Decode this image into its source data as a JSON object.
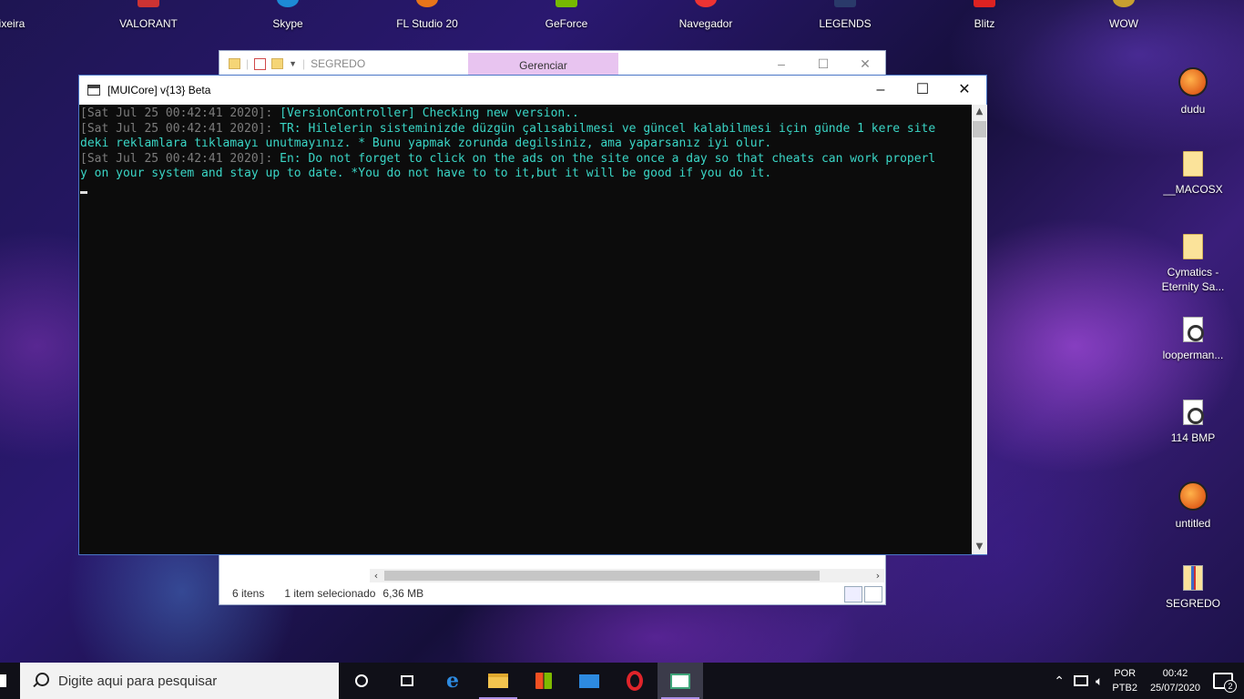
{
  "desktop_top_icons": [
    {
      "label": "ixeira"
    },
    {
      "label": "VALORANT"
    },
    {
      "label": "Skype"
    },
    {
      "label": "FL Studio 20"
    },
    {
      "label": "GeForce"
    },
    {
      "label": "Navegador"
    },
    {
      "label": "LEGENDS"
    },
    {
      "label": "Blitz"
    },
    {
      "label": "WOW"
    }
  ],
  "desktop_right_icons": [
    {
      "label": "dudu",
      "icon": "fl-studio-project-icon"
    },
    {
      "label": "__MACOSX",
      "icon": "folder-icon"
    },
    {
      "label": "Cymatics - Eternity Sa...",
      "icon": "folder-icon"
    },
    {
      "label": "looperman...",
      "icon": "audio-file-icon"
    },
    {
      "label": "114 BMP",
      "icon": "audio-file-icon"
    },
    {
      "label": "untitled",
      "icon": "fl-studio-project-icon"
    },
    {
      "label": "SEGREDO",
      "icon": "zip-archive-icon"
    }
  ],
  "explorer": {
    "title": "SEGREDO",
    "context_tab": "Gerenciar",
    "status_items": "6 itens",
    "status_selected": "1 item selecionado",
    "status_size": "6,36 MB"
  },
  "console": {
    "title": "[MUICore] v{13} Beta",
    "lines": [
      {
        "ts": "[Sat Jul 25 00:42:41 2020]: ",
        "text": "[VersionController] Checking new version.."
      },
      {
        "ts": "[Sat Jul 25 00:42:41 2020]: ",
        "text": "TR: Hilelerin sisteminizde düzgün çalısabilmesi ve güncel kalabilmesi için günde 1 kere site"
      },
      {
        "ts": "",
        "text": "deki reklamlara tıklamayı unutmayınız. * Bunu yapmak zorunda degilsiniz, ama yaparsanız iyi olur."
      },
      {
        "ts": "[Sat Jul 25 00:42:41 2020]: ",
        "text": "En: Do not forget to click on the ads on the site once a day so that cheats can work properl"
      },
      {
        "ts": "",
        "text": "y on your system and stay up to date. *You do not have to to it,but it will be good if you do it."
      }
    ]
  },
  "taskbar": {
    "search_placeholder": "Digite aqui para pesquisar",
    "lang_primary": "POR",
    "lang_secondary": "PTB2",
    "time": "00:42",
    "date": "25/07/2020",
    "notification_count": "2"
  }
}
